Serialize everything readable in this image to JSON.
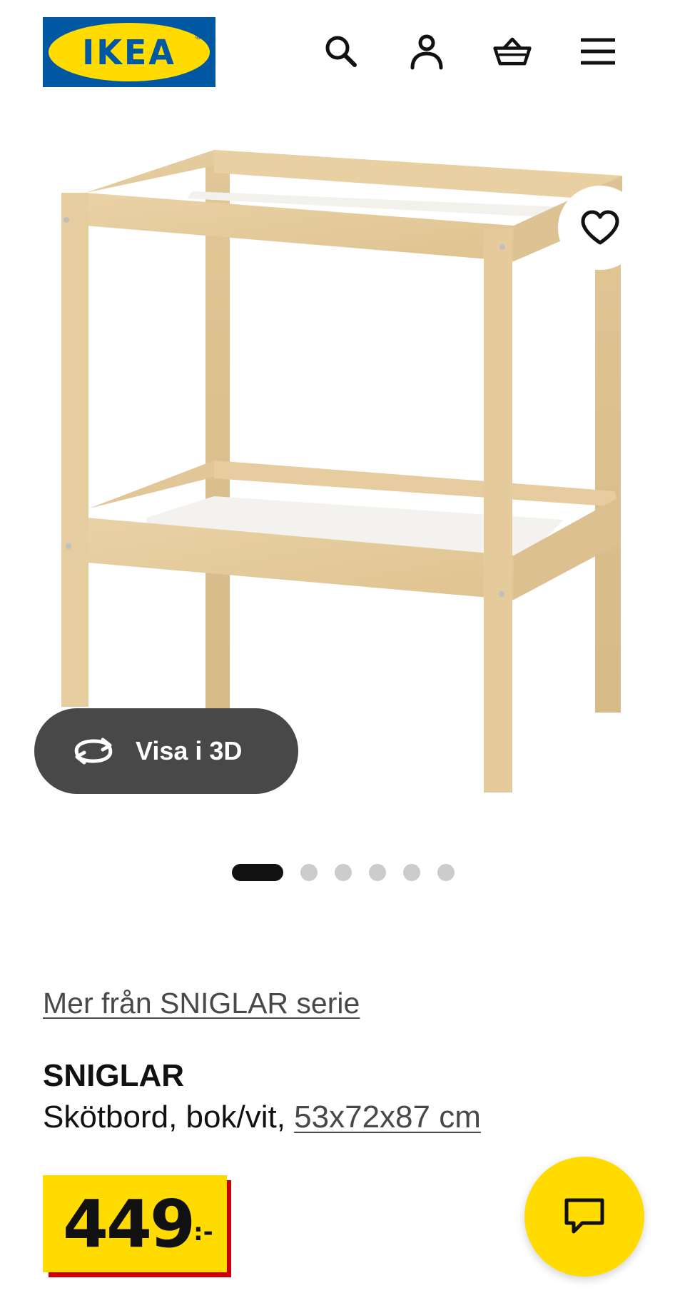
{
  "header": {
    "logo_text": "IKEA",
    "logo_mark": "®",
    "icons": [
      "search-icon",
      "user-icon",
      "basket-icon",
      "menu-icon"
    ]
  },
  "gallery": {
    "view_3d_label": "Visa i 3D",
    "image_count": 6,
    "active_index": 0
  },
  "product": {
    "series_link": "Mer från SNIGLAR serie",
    "name": "SNIGLAR",
    "description": "Skötbord, bok/vit, ",
    "dimensions": "53x72x87 cm",
    "price_integer": "449",
    "price_suffix": ":-"
  },
  "colors": {
    "brand_blue": "#0058a3",
    "brand_yellow": "#ffdb00",
    "price_shadow_red": "#cc0008",
    "button_dark": "#484848"
  }
}
